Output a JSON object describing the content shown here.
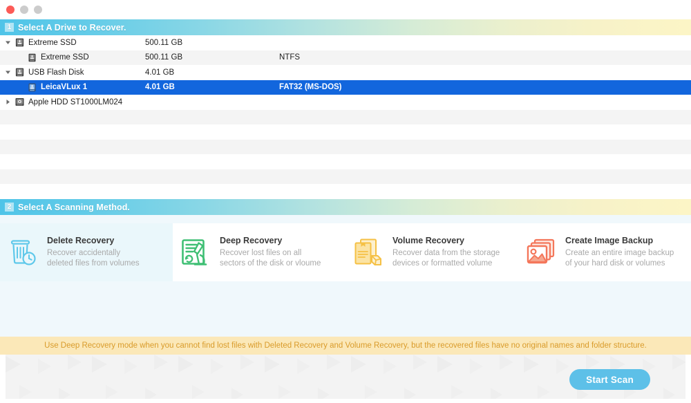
{
  "window": {
    "traffic_lights": [
      {
        "name": "close",
        "color": "#fc5b57"
      },
      {
        "name": "minimize",
        "color": "#cccccc"
      },
      {
        "name": "maximize",
        "color": "#cccccc"
      }
    ]
  },
  "step1": {
    "number": "1",
    "title": "Select A Drive to Recover."
  },
  "drives": {
    "rows": [
      {
        "name": "Extreme SSD",
        "size": "500.11 GB",
        "fs": "",
        "level": "parent",
        "twisty": "down",
        "icon": "disk-icon",
        "selected": false
      },
      {
        "name": "Extreme SSD",
        "size": "500.11 GB",
        "fs": "NTFS",
        "level": "child",
        "twisty": "none",
        "icon": "volume-icon",
        "selected": false
      },
      {
        "name": "USB Flash Disk",
        "size": "4.01 GB",
        "fs": "",
        "level": "parent",
        "twisty": "down",
        "icon": "disk-icon",
        "selected": false
      },
      {
        "name": "LeicaVLux 1",
        "size": "4.01 GB",
        "fs": "FAT32 (MS-DOS)",
        "level": "child",
        "twisty": "none",
        "icon": "volume-icon",
        "selected": true
      },
      {
        "name": "Apple HDD ST1000LM024",
        "size": "",
        "fs": "",
        "level": "parent",
        "twisty": "right",
        "icon": "hard-disk-icon",
        "selected": false
      }
    ]
  },
  "step2": {
    "number": "2",
    "title": "Select A Scanning Method."
  },
  "methods": [
    {
      "id": "delete-recovery",
      "title": "Delete Recovery",
      "desc_line1": "Recover accidentally",
      "desc_line2": "deleted files from volumes",
      "icon": "trash-clock-icon",
      "color": "#5ec8ea",
      "selected": true
    },
    {
      "id": "deep-recovery",
      "title": "Deep Recovery",
      "desc_line1": "Recover lost files on all",
      "desc_line2": "sectors of the disk or vloume",
      "icon": "microscope-document-icon",
      "color": "#3fbf74",
      "selected": false
    },
    {
      "id": "volume-recovery",
      "title": "Volume Recovery",
      "desc_line1": "Recover data from the storage",
      "desc_line2": "devices or formatted volume",
      "icon": "documents-box-icon",
      "color": "#f5c044",
      "selected": false
    },
    {
      "id": "create-image-backup",
      "title": "Create Image Backup",
      "desc_line1": "Create an entire image backup",
      "desc_line2": "of your hard disk or volumes",
      "icon": "image-stack-icon",
      "color": "#f4765a",
      "selected": false
    }
  ],
  "warning": {
    "text": "Use Deep Recovery mode when you cannot find lost files with Deleted Recovery and Volume Recovery, but the recovered files have no original names and folder structure."
  },
  "footer": {
    "start_button": "Start Scan",
    "accent_color": "#5dc0e8"
  }
}
